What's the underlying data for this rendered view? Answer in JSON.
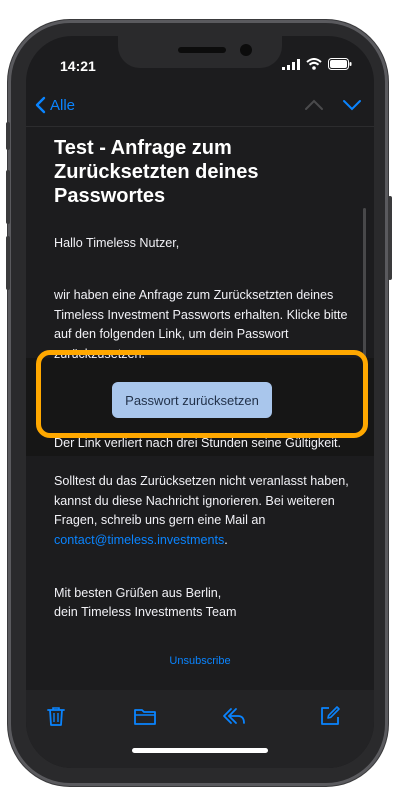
{
  "status": {
    "time": "14:21"
  },
  "nav": {
    "back_label": "Alle"
  },
  "email": {
    "subject": "Test - Anfrage zum Zurücksetzten deines Passwortes",
    "greeting": "Hallo Timeless Nutzer,",
    "intro": "wir haben eine Anfrage zum Zurücksetzten deines Timeless Investment Passworts erhalten. Klicke bitte auf den folgenden Link, um dein Passwort zurückzusetzen.",
    "button_label": "Passwort zurücksetzen",
    "expiry": "Der Link verliert nach drei Stunden seine Gültigkeit.",
    "ignore_text": "Solltest du das Zurücksetzen nicht veranlasst haben, kannst du diese Nachricht ignorieren. Bei weiteren Fragen, schreib uns gern eine Mail an",
    "contact_email": "contact@timeless.investments",
    "closing_1": "Mit besten Grüßen aus Berlin,",
    "closing_2": "dein Timeless Investments Team",
    "unsubscribe": "Unsubscribe"
  },
  "colors": {
    "accent": "#0a84ff",
    "highlight": "#ffa800",
    "button_bg": "#a9c6ec",
    "background": "#1c1c1e"
  },
  "toolbar": {
    "icons": [
      "trash-icon",
      "folder-icon",
      "reply-icon",
      "compose-icon"
    ]
  }
}
